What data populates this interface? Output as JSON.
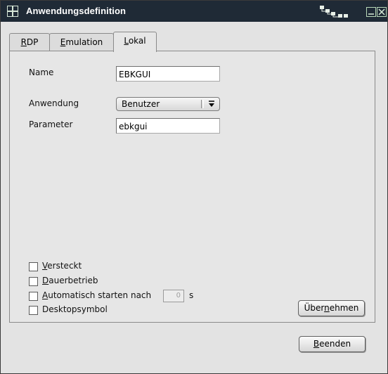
{
  "window": {
    "title": "Anwendungsdefinition"
  },
  "tabs": [
    {
      "label": "RDP",
      "mnemonic": "R",
      "rest": "DP"
    },
    {
      "label": "Emulation",
      "mnemonic": "E",
      "rest": "mulation"
    },
    {
      "label": "Lokal",
      "mnemonic": "L",
      "rest": "okal",
      "active": true
    }
  ],
  "form": {
    "name_label": "Name",
    "name_value": "EBKGUI",
    "application_label": "Anwendung",
    "application_value": "Benutzer",
    "parameter_label": "Parameter",
    "parameter_value": "ebkgui"
  },
  "options": {
    "hidden": {
      "mnemonic": "V",
      "rest": "ersteckt",
      "checked": false
    },
    "permanent": {
      "mnemonic": "D",
      "rest": "auerbetrieb",
      "checked": false
    },
    "autostart": {
      "mnemonic": "A",
      "rest": "utomatisch starten nach",
      "checked": false,
      "delay_value": "0",
      "unit": "s"
    },
    "desktop": {
      "label": "Desktopsymbol",
      "checked": false
    }
  },
  "buttons": {
    "apply": {
      "before": "Über",
      "mnemonic": "n",
      "after": "ehmen"
    },
    "close": {
      "mnemonic": "B",
      "rest": "eenden"
    }
  },
  "colors": {
    "titlebar": "#1f2a36",
    "window": "#e3e3e3",
    "accent": "#b8d8b8"
  }
}
